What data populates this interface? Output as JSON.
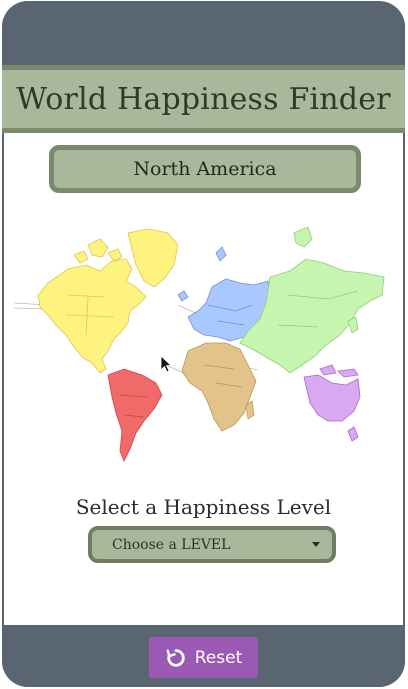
{
  "app": {
    "title": "World Happiness Finder"
  },
  "region": {
    "selected": "North America"
  },
  "map": {
    "icon": "world-map",
    "colors": {
      "north_america": "#fff380",
      "south_america": "#f06a6a",
      "europe": "#a9c8ff",
      "africa": "#e2c48a",
      "asia": "#c6f5b0",
      "oceania": "#d9a8f0"
    }
  },
  "happiness": {
    "label": "Select a Happiness Level",
    "dropdown_value": "Choose a LEVEL"
  },
  "reset": {
    "label": "Reset",
    "icon": "refresh-icon"
  },
  "colors": {
    "frame": "#5a6572",
    "accent": "#a9b89a",
    "accent_border": "#7b8a6d",
    "button": "#9b59b6"
  }
}
